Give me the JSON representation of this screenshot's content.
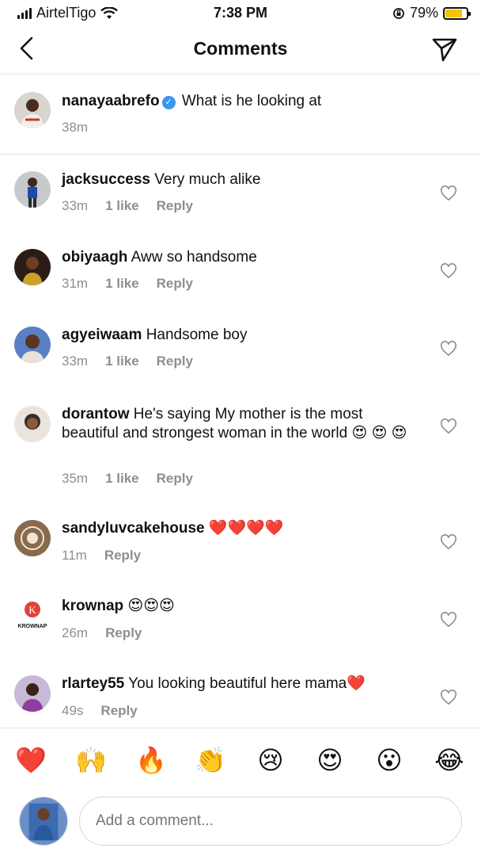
{
  "status_bar": {
    "carrier": "AirtelTigo",
    "time": "7:38 PM",
    "battery": "79%",
    "battery_level": 0.79
  },
  "header": {
    "title": "Comments"
  },
  "caption": {
    "user": "nanayaabrefo",
    "text": "What is he looking at",
    "time": "38m",
    "verified": true
  },
  "comments": [
    {
      "user": "jacksuccess",
      "text": "Very much alike",
      "time": "33m",
      "likes": "1 like",
      "reply": "Reply"
    },
    {
      "user": "obiyaagh",
      "text": "Aww so handsome",
      "time": "31m",
      "likes": "1 like",
      "reply": "Reply"
    },
    {
      "user": "agyeiwaam",
      "text": "Handsome boy",
      "time": "33m",
      "likes": "1 like",
      "reply": "Reply"
    },
    {
      "user": "dorantow",
      "text": "He's saying My mother is the most beautiful and strongest woman in the world 😍 😍 😍",
      "time": "35m",
      "likes": "1 like",
      "reply": "Reply"
    },
    {
      "user": "sandyluvcakehouse",
      "text": "❤️❤️❤️❤️",
      "time": "11m",
      "reply": "Reply"
    },
    {
      "user": "krownap",
      "text": "😍😍😍",
      "time": "26m",
      "reply": "Reply",
      "avatar_text": "KROWNAP"
    },
    {
      "user": "rlartey55",
      "text": "You looking beautiful here mama❤️",
      "time": "49s",
      "reply": "Reply"
    }
  ],
  "emoji_bar": [
    "❤️",
    "🙌",
    "🔥",
    "👏",
    "😢",
    "😍",
    "😮",
    "😂"
  ],
  "composer": {
    "placeholder": "Add a comment..."
  },
  "colors": {
    "link": "#3897f0",
    "muted": "#8e8e8e",
    "battery": "#f5c400"
  }
}
